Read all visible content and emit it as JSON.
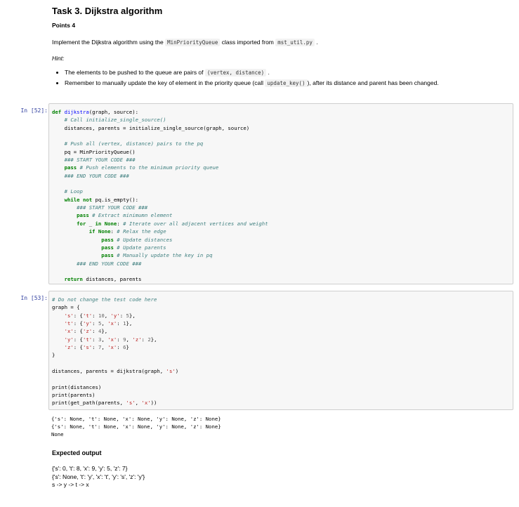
{
  "task": {
    "title": "Task 3. Dijkstra algorithm",
    "points": "Points 4",
    "intro_a": "Implement the Dijkstra algorithm using the ",
    "intro_code1": "MinPriorityQueue",
    "intro_b": " class imported from ",
    "intro_code2": "mst_util.py",
    "intro_c": " .",
    "hint": "Hint:",
    "bullets": [
      {
        "a": "The elements to be pushed to the queue are pairs of ",
        "code": "(vertex, distance)",
        "b": " ."
      },
      {
        "a": "Remember to manually update the key of element in the priority queue (call ",
        "code": "update_key()",
        "b": "), after its distance and parent has been changed."
      }
    ]
  },
  "cells": [
    {
      "prompt": "In [52]:"
    },
    {
      "prompt": "In [53]:"
    }
  ],
  "output": {
    "lines": [
      "{'s': None, 't': None, 'x': None, 'y': None, 'z': None}",
      "{'s': None, 't': None, 'x': None, 'y': None, 'z': None}",
      "None"
    ]
  },
  "expected": {
    "heading": "Expected output",
    "lines": [
      "{'s': 0, 't': 8, 'x': 9, 'y': 5, 'z': 7}",
      "{'s': None, 't': 'y', 'x': 't', 'y': 's', 'z': 'y'}",
      "s -> y -> t -> x"
    ]
  },
  "code_cell_1": [
    "def dijkstra(graph, source):",
    "    # Call initialize_single_source()",
    "    distances, parents = initialize_single_source(graph, source)",
    "",
    "    # Push all (vertex, distance) pairs to the pq",
    "    pq = MinPriorityQueue()",
    "    ### START YOUR CODE ###",
    "    pass # Push elements to the minimum priority queue",
    "    ### END YOUR CODE ###",
    "",
    "    # Loop",
    "    while not pq.is_empty():",
    "        ### START YOUR CODE ###",
    "        pass # Extract minimumn element",
    "        for _ in None: # Iterate over all adjacent vertices and weight",
    "            if None: # Relax the edge",
    "                pass # Update distances",
    "                pass # Update parents",
    "                pass # Manually update the key in pq",
    "        ### END YOUR CODE ###",
    "",
    "    return distances, parents"
  ],
  "code_cell_2": [
    "# Do not change the test code here",
    "graph = {",
    "    's': {'t': 10, 'y': 5},",
    "    't': {'y': 5, 'x': 1},",
    "    'x': {'z': 4},",
    "    'y': {'t': 3, 'x': 9, 'z': 2},",
    "    'z': {'s': 7, 'x': 6}",
    "}",
    "",
    "distances, parents = dijkstra(graph, 's')",
    "",
    "print(distances)",
    "print(parents)",
    "print(get_path(parents, 's', 'x'))"
  ]
}
